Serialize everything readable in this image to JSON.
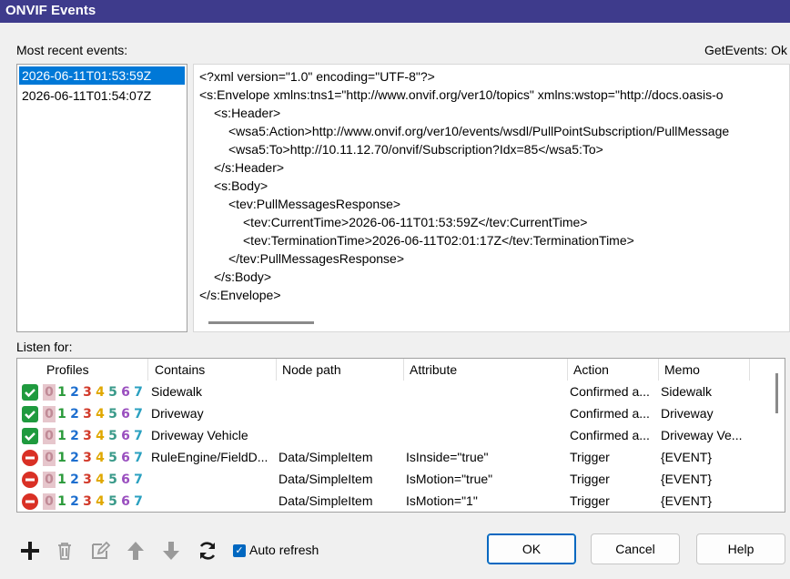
{
  "window": {
    "title": "ONVIF Events"
  },
  "recent": {
    "label": "Most recent events:",
    "status": "GetEvents: Ok",
    "items": [
      "2026-06-11T01:53:59Z",
      "2026-06-11T01:54:07Z"
    ],
    "selected_index": 0
  },
  "xml": {
    "lines": [
      "<?xml version=\"1.0\" encoding=\"UTF-8\"?>",
      "<s:Envelope xmlns:tns1=\"http://www.onvif.org/ver10/topics\" xmlns:wstop=\"http://docs.oasis-o",
      "<s:Header>",
      "<wsa5:Action>http://www.onvif.org/ver10/events/wsdl/PullPointSubscription/PullMessage",
      "<wsa5:To>http://10.11.12.70/onvif/Subscription?Idx=85</wsa5:To>",
      "</s:Header>",
      "<s:Body>",
      "<tev:PullMessagesResponse>",
      "<tev:CurrentTime>2026-06-11T01:53:59Z</tev:CurrentTime>",
      "<tev:TerminationTime>2026-06-11T02:01:17Z</tev:TerminationTime>",
      "</tev:PullMessagesResponse>",
      "</s:Body>",
      "</s:Envelope>"
    ]
  },
  "listen": {
    "label": "Listen for:",
    "columns": [
      "Profiles",
      "Contains",
      "Node path",
      "Attribute",
      "Action",
      "Memo"
    ],
    "profile_digits": [
      "0",
      "1",
      "2",
      "3",
      "4",
      "5",
      "6",
      "7"
    ],
    "rows": [
      {
        "state": "enabled",
        "contains": "Sidewalk",
        "node_path": "",
        "attribute": "",
        "action": "Confirmed a...",
        "memo": "Sidewalk"
      },
      {
        "state": "enabled",
        "contains": "Driveway",
        "node_path": "",
        "attribute": "",
        "action": "Confirmed a...",
        "memo": "Driveway"
      },
      {
        "state": "enabled",
        "contains": "Driveway Vehicle",
        "node_path": "",
        "attribute": "",
        "action": "Confirmed a...",
        "memo": "Driveway Ve..."
      },
      {
        "state": "disabled",
        "contains": "RuleEngine/FieldD...",
        "node_path": "Data/SimpleItem",
        "attribute": "IsInside=\"true\"",
        "action": "Trigger",
        "memo": "{EVENT}"
      },
      {
        "state": "disabled",
        "contains": "",
        "node_path": "Data/SimpleItem",
        "attribute": "IsMotion=\"true\"",
        "action": "Trigger",
        "memo": "{EVENT}"
      },
      {
        "state": "disabled",
        "contains": "",
        "node_path": "Data/SimpleItem",
        "attribute": "IsMotion=\"1\"",
        "action": "Trigger",
        "memo": "{EVENT}"
      }
    ]
  },
  "toolbar": {
    "icons": [
      "add-icon",
      "trash-icon",
      "edit-icon",
      "arrow-up-icon",
      "arrow-down-icon",
      "refresh-icon"
    ],
    "auto_refresh_label": "Auto refresh",
    "auto_refresh_checked": true
  },
  "buttons": {
    "ok": "OK",
    "cancel": "Cancel",
    "help": "Help"
  },
  "colors": {
    "title_bar": "#3e3b8c",
    "selection": "#0078d7",
    "enabled_icon": "#1f9a3e",
    "disabled_icon": "#d93025",
    "digit_colors": [
      "#c08a96",
      "#2a9a3a",
      "#1e6fcf",
      "#d23a2a",
      "#e0a800",
      "#3a9a8a",
      "#9a4fbf",
      "#2aa0c0"
    ]
  }
}
